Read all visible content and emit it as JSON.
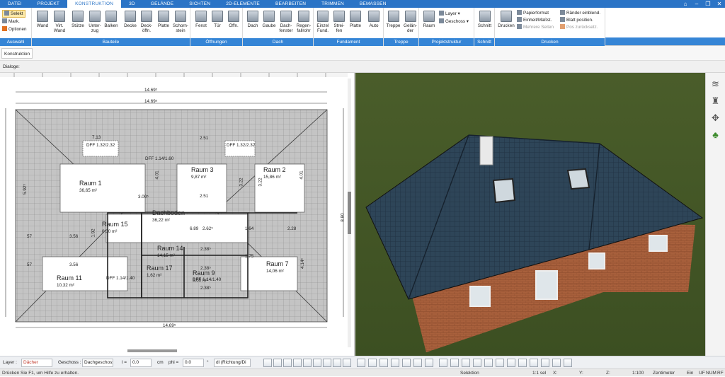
{
  "menu": {
    "tabs": [
      "DATEI",
      "PROJEKT",
      "KONSTRUKTION",
      "3D",
      "GELÄNDE",
      "SICHTEN",
      "2D-ELEMENTE",
      "BEARBEITEN",
      "TRIMMEN",
      "BEMASSEN"
    ]
  },
  "ribbon": {
    "auswahl": {
      "label": "Auswahl",
      "selekt": "Selekt",
      "mark": "Mark.",
      "optionen": "Optionen"
    },
    "bauteile": {
      "label": "Bauteile",
      "tools": [
        "Wand",
        "Virt. Wand",
        "Stütze",
        "Unter-zug",
        "Balken",
        "Decke",
        "Deck-öffn.",
        "Platte",
        "Schorn-stein"
      ]
    },
    "oeffnungen": {
      "label": "Öffnungen",
      "tools": [
        "Fenst",
        "Tür",
        "Öffn."
      ]
    },
    "dach": {
      "label": "Dach",
      "tools": [
        "Dach",
        "Gaube",
        "Dach-fenster",
        "Regen-fallrohr"
      ]
    },
    "fundament": {
      "label": "Fundament",
      "tools": [
        "Einzel Fund.",
        "Strei-fen",
        "Platte",
        "Auto"
      ]
    },
    "treppe": {
      "label": "Treppe",
      "tools": [
        "Treppe",
        "Gelän-der"
      ]
    },
    "projektstruktur": {
      "label": "Projektstruktur",
      "raum": "Raum",
      "layer": "Layer",
      "geschoss": "Geschoss"
    },
    "schnitt": {
      "label": "Schnitt",
      "tool": "Schnitt"
    },
    "drucken": {
      "label": "Drucken",
      "tool": "Drucken",
      "papierformat": "Papierformat",
      "einheit": "Einheit/Maßst.",
      "mehrere": "Mehrere Seiten",
      "raender": "Ränder einblend.",
      "blatt": "Blatt position.",
      "pos": "Pos zurücksetz."
    }
  },
  "strip": {
    "konstruktion": "Konstruktion",
    "dialoge": "Dialoge:"
  },
  "plan": {
    "dims": {
      "top1": "14.69⁵",
      "top2": "14.69⁵",
      "bottom": "14.69⁵",
      "right": "8.80",
      "left": "5.92⁵"
    },
    "rooms": [
      {
        "name": "Raum 1",
        "area": "36,65 m²"
      },
      {
        "name": "Raum 3",
        "area": "9,87 m²"
      },
      {
        "name": "Raum 2",
        "area": "15,86 m²"
      },
      {
        "name": "Dachboden",
        "area": "36,22 m²"
      },
      {
        "name": "Raum 15",
        "area": "0,00 m²"
      },
      {
        "name": "Raum 14",
        "area": "14,15 m²"
      },
      {
        "name": "Raum 17",
        "area": "1,62 m²"
      },
      {
        "name": "Raum 9",
        "area": "5,55 m²"
      },
      {
        "name": "Raum 7",
        "area": "14,06 m²"
      },
      {
        "name": "Raum 11",
        "area": "10,32 m²"
      }
    ],
    "labels": [
      "DFF 1.32/2.32",
      "DFF 1.32/2.32",
      "DFF 1.14/1.60",
      "DFF 1.14/1.40",
      "DFF 1.14/1.40",
      "7.13",
      "2.51",
      "3.00⁵",
      "2.51",
      "6.89",
      "2.62⁵",
      "3.56",
      "3.56",
      "1.92",
      "57",
      "57",
      "4.01",
      "4.01",
      "3.22",
      "3.22",
      "1.75",
      "2.38⁵",
      "2.38⁵",
      "2.38⁵",
      "4.14⁵",
      "2.28",
      "1.64"
    ]
  },
  "bottom": {
    "layer_label": "Layer :",
    "layer_value": "Dächer",
    "geschoss_label": "Geschoss :",
    "geschoss_value": "Dachgeschoss",
    "l_label": "l =",
    "l_value": "0.0",
    "unit": "cm",
    "phi_label": "phi =",
    "phi_value": "0.0",
    "deg": "°",
    "dl": "dl (Richtung/Di"
  },
  "status": {
    "hint": "Drücken Sie F1, um Hilfe zu erhalten.",
    "mode": "Selektion",
    "sel": "1:1 sel",
    "x": "X:",
    "y": "Y:",
    "z": "Z:",
    "scale": "1:100",
    "unit": "Zentimeter",
    "ein": "Ein",
    "uf": "UF",
    "num": "NUM",
    "rf": "RF"
  }
}
